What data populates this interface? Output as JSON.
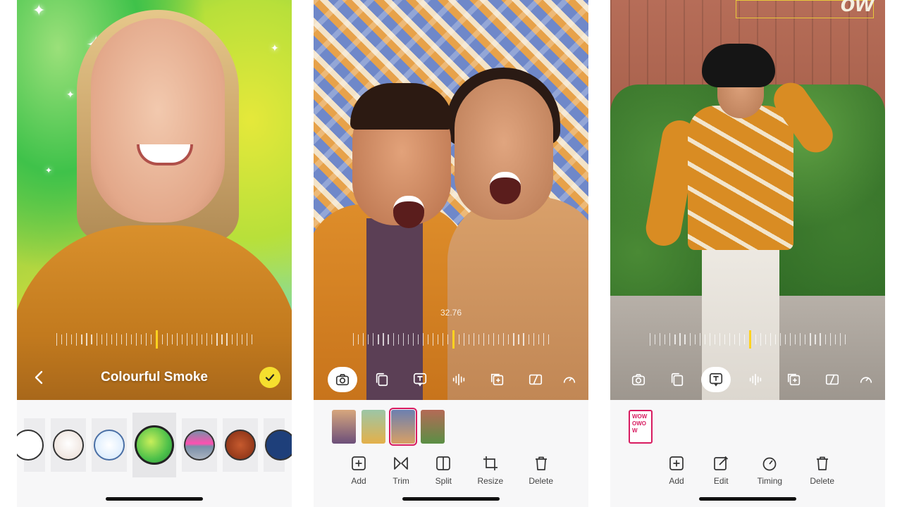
{
  "screen1": {
    "filter_name": "Colourful Smoke",
    "back_icon": "chevron-left-icon",
    "confirm_icon": "checkmark-icon",
    "accent_color": "#f5df2e",
    "effects": [
      {
        "name": "effect-partial-face"
      },
      {
        "name": "effect-cartoon-face"
      },
      {
        "name": "effect-smiley-face"
      },
      {
        "name": "effect-colourful-smoke",
        "selected": true
      },
      {
        "name": "effect-glitch"
      },
      {
        "name": "effect-red-face"
      },
      {
        "name": "effect-blue-figure"
      }
    ]
  },
  "screen2": {
    "timestamp": "32.76",
    "toolbar": [
      "camera-icon",
      "duplicate-icon",
      "text-icon",
      "audio-icon",
      "add-clip-icon",
      "crop-aspect-icon",
      "speed-icon"
    ],
    "toolbar_active": "camera-icon",
    "thumbnails": 4,
    "selected_thumbnail": 3,
    "actions": [
      {
        "icon": "plus-square-icon",
        "label": "Add"
      },
      {
        "icon": "trim-icon",
        "label": "Trim"
      },
      {
        "icon": "split-icon",
        "label": "Split"
      },
      {
        "icon": "crop-icon",
        "label": "Resize"
      },
      {
        "icon": "trash-icon",
        "label": "Delete"
      }
    ]
  },
  "screen3": {
    "sticker_text": "ow",
    "text_clip_lines": [
      "WOW",
      "OWO",
      "W"
    ],
    "toolbar": [
      "camera-icon",
      "duplicate-icon",
      "text-icon",
      "audio-icon",
      "add-clip-icon",
      "crop-aspect-icon",
      "speed-icon"
    ],
    "toolbar_active": "text-icon",
    "actions": [
      {
        "icon": "plus-square-icon",
        "label": "Add"
      },
      {
        "icon": "edit-icon",
        "label": "Edit"
      },
      {
        "icon": "timing-icon",
        "label": "Timing"
      },
      {
        "icon": "trash-icon",
        "label": "Delete"
      }
    ],
    "highlight_color": "#d81b60"
  }
}
